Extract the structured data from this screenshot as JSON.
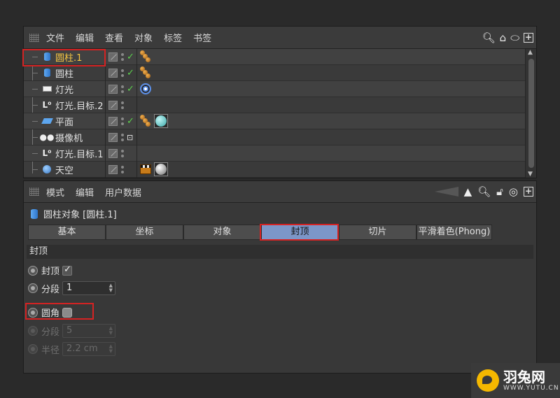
{
  "object_manager": {
    "menu": [
      "文件",
      "编辑",
      "查看",
      "对象",
      "标签",
      "书签"
    ],
    "objects": [
      {
        "name": "圆柱.1",
        "icon": "cylinder-icon",
        "selected": true,
        "tags": [
          "phong-tag"
        ]
      },
      {
        "name": "圆柱",
        "icon": "cylinder-icon",
        "selected": false,
        "tags": [
          "phong-tag"
        ]
      },
      {
        "name": "灯光",
        "icon": "light-icon",
        "selected": false,
        "tags": [
          "target-tag"
        ]
      },
      {
        "name": "灯光.目标.2",
        "icon": "null-target-icon",
        "selected": false,
        "tags": []
      },
      {
        "name": "平面",
        "icon": "plane-icon",
        "selected": false,
        "tags": [
          "phong-tag",
          "material-tag-cyan"
        ]
      },
      {
        "name": "摄像机",
        "icon": "camera-icon",
        "selected": false,
        "tags": []
      },
      {
        "name": "灯光.目标.1",
        "icon": "null-target-icon",
        "selected": false,
        "tags": []
      },
      {
        "name": "天空",
        "icon": "sky-icon",
        "selected": false,
        "tags": [
          "clapper-tag",
          "material-tag-gray"
        ]
      }
    ]
  },
  "attribute_manager": {
    "menu": [
      "模式",
      "编辑",
      "用户数据"
    ],
    "object_title": "圆柱对象 [圆柱.1]",
    "tabs": [
      "基本",
      "坐标",
      "对象",
      "封顶",
      "切片",
      "平滑着色(Phong)"
    ],
    "active_tab": "封顶",
    "section_title": "封顶",
    "params": {
      "caps_label": "封顶",
      "caps_checked": true,
      "segments_label": "分段",
      "segments_value": "1",
      "fillet_label": "圆角",
      "fillet_checked": false,
      "fillet_segments_label": "分段",
      "fillet_segments_value": "5",
      "radius_label": "半径",
      "radius_value": "2.2 cm"
    }
  },
  "watermark": {
    "main": "羽兔网",
    "sub": "WWW.YUTU.CN"
  },
  "colors": {
    "selected_name": "#f5c542",
    "active_tab": "#7c96c8",
    "highlight_box": "#d42323",
    "check_green": "#5cd14d"
  }
}
